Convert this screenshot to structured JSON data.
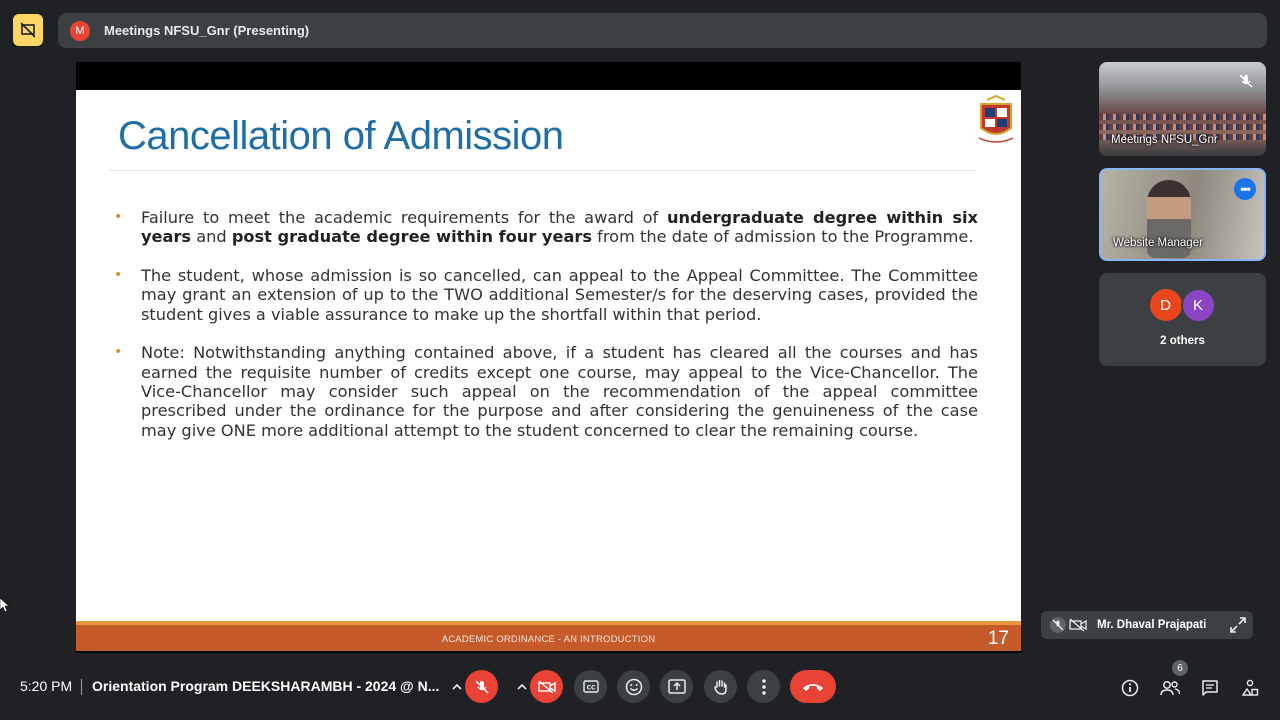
{
  "top_bar": {
    "avatar_letter": "M",
    "title": "Meetings NFSU_Gnr (Presenting)"
  },
  "slide": {
    "title": "Cancellation of Admission",
    "bullets": [
      {
        "parts": [
          {
            "text": "Failure to meet the academic requirements for the award of ",
            "bold": false
          },
          {
            "text": "undergraduate degree within six years",
            "bold": true
          },
          {
            "text": " and ",
            "bold": false
          },
          {
            "text": "post graduate degree within four years",
            "bold": true
          },
          {
            "text": " from the date of admission to the Programme.",
            "bold": false
          }
        ]
      },
      {
        "parts": [
          {
            "text": "The student, whose admission is so cancelled, can appeal to the Appeal Committee. The Committee may grant an extension of up to the TWO additional Semester/s for the deserving cases, provided the student gives a viable assurance to make up the shortfall within that period.",
            "bold": false
          }
        ]
      },
      {
        "parts": [
          {
            "text": "Note: Notwithstanding anything contained above, if a student has cleared all the courses and has earned the requisite number of credits except one course, may appeal to the Vice-Chancellor. The Vice-Chancellor may consider such appeal on the recommendation of the appeal committee prescribed under the ordinance for the purpose and after considering the genuineness of the case may give ONE more additional attempt to the student concerned to clear the remaining course.",
            "bold": false
          }
        ]
      }
    ],
    "footer": "ACADEMIC ORDINANCE - AN INTRODUCTION",
    "page_number": "17",
    "accent_color": "#c55a2b",
    "title_color": "#1f6fa6"
  },
  "tiles": [
    {
      "label": "Meetings NFSU_Gnr",
      "icon": "mic-off-icon"
    },
    {
      "label": "Website Manager",
      "icon": "more-options-icon"
    },
    {
      "label": "2 others",
      "avatars": [
        "D",
        "K"
      ]
    }
  ],
  "presenter": {
    "name": "Mr. Dhaval Prajapati"
  },
  "bottom_bar": {
    "time": "5:20 PM",
    "meeting_name": "Orientation Program DEEKSHARAMBH - 2024 @ N...",
    "participants_count": "6"
  }
}
